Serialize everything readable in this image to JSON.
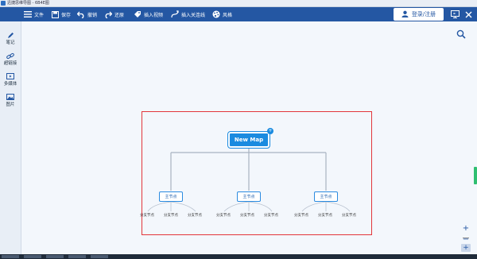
{
  "window": {
    "title": "迅捷思维导图 - 6B4E图"
  },
  "toolbar": {
    "menu_label": "文件",
    "save_label": "保存",
    "undo_label": "撤销",
    "redo_label": "还原",
    "insert_image_label": "插入视频",
    "insert_link_label": "插入关连线",
    "style_label": "风格",
    "login_label": "登录/注册"
  },
  "sidebar": {
    "items": [
      {
        "label": "笔记",
        "icon": "pencil-icon"
      },
      {
        "label": "超链接",
        "icon": "link-icon"
      },
      {
        "label": "多媒体",
        "icon": "media-icon"
      },
      {
        "label": "图片",
        "icon": "image-icon"
      }
    ]
  },
  "mindmap": {
    "root": "New Map",
    "main_nodes": [
      {
        "label": "主节点",
        "children": [
          "分支节点",
          "分支节点",
          "分支节点"
        ]
      },
      {
        "label": "主节点",
        "children": [
          "分支节点",
          "分支节点",
          "分支节点"
        ]
      },
      {
        "label": "主节点",
        "children": [
          "分支节点",
          "分支节点",
          "分支节点"
        ]
      }
    ]
  },
  "colors": {
    "toolbar_bg": "#2457a3",
    "node_blue": "#1a8be0",
    "highlight_red": "#e2363b"
  }
}
